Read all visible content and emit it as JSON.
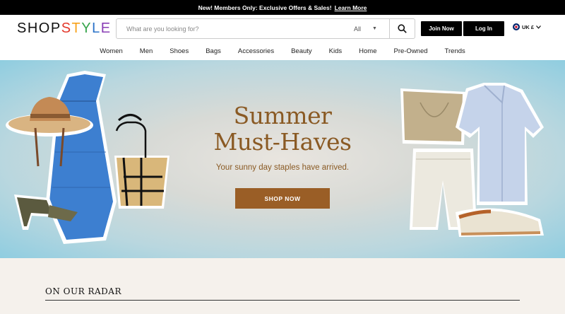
{
  "promo": {
    "text": "New! Members Only: Exclusive Offers & Sales!",
    "link": "Learn More"
  },
  "header": {
    "logo": {
      "part1": "SHOP",
      "part2": [
        "S",
        "T",
        "Y",
        "L",
        "E"
      ]
    },
    "search": {
      "placeholder": "What are you looking for?",
      "category": "All"
    },
    "join_label": "Join Now",
    "login_label": "Log In",
    "locale": "UK £"
  },
  "nav": {
    "items": [
      "Women",
      "Men",
      "Shoes",
      "Bags",
      "Accessories",
      "Beauty",
      "Kids",
      "Home",
      "Pre-Owned",
      "Trends"
    ]
  },
  "hero": {
    "title_line1": "Summer",
    "title_line2": "Must-Haves",
    "subtitle": "Your sunny day staples have arrived.",
    "cta": "SHOP NOW",
    "accent": "#9a5e26"
  },
  "radar": {
    "title": "ON OUR RADAR"
  }
}
